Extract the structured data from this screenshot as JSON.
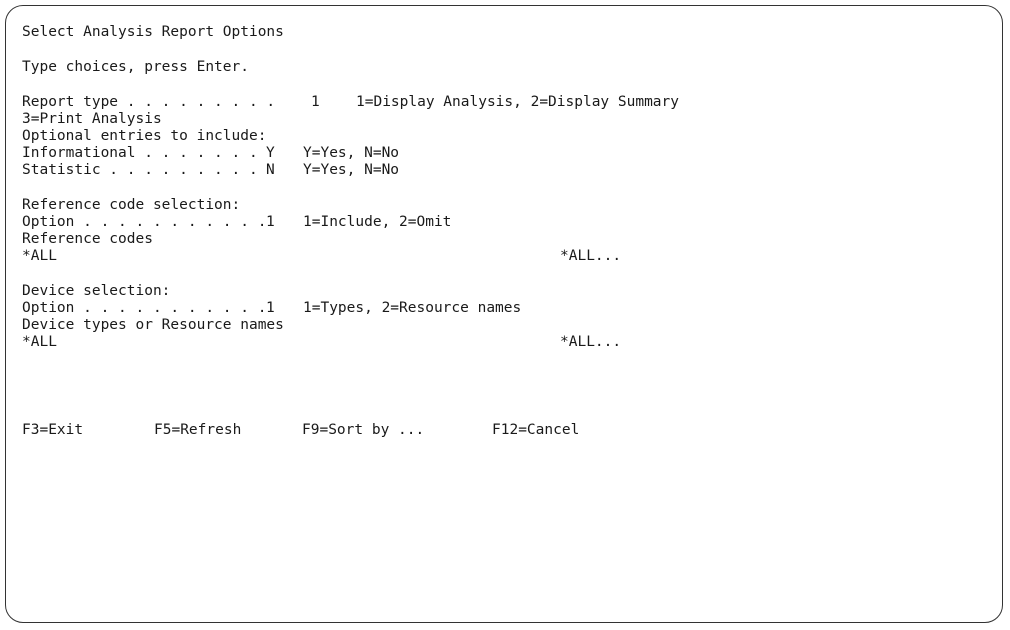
{
  "screen": {
    "title": "Select Analysis Report Options",
    "instruction": "Type choices, press Enter."
  },
  "report_type": {
    "label": "Report type . . . . . . . . .",
    "value": "1",
    "choices": "1=Display Analysis, 2=Display Summary",
    "choices_cont": "3=Print Analysis"
  },
  "optional": {
    "heading": "Optional entries to include:",
    "informational": {
      "label": "Informational . . . . . . .",
      "value": "Y",
      "choices": "Y=Yes, N=No"
    },
    "statistic": {
      "label": "Statistic . . . . . . . . .",
      "value": "N",
      "choices": "Y=Yes, N=No"
    }
  },
  "reference": {
    "heading": "Reference code selection:",
    "option_label": "Option . . . . . . . . . . .",
    "option_value": "1",
    "option_choices": "1=Include, 2=Omit",
    "codes_label": "Reference codes",
    "codes_value": "*ALL",
    "codes_hint": "*ALL..."
  },
  "device": {
    "heading": "Device selection:",
    "option_label": "Option . . . . . . . . . . .",
    "option_value": "1",
    "option_choices": "1=Types, 2=Resource names",
    "names_label": "Device types or Resource names",
    "names_value": "*ALL",
    "names_hint": "*ALL..."
  },
  "function_keys": [
    {
      "label": "F3=Exit"
    },
    {
      "label": "F5=Refresh"
    },
    {
      "label": "F9=Sort by ..."
    },
    {
      "label": "F12=Cancel"
    }
  ]
}
